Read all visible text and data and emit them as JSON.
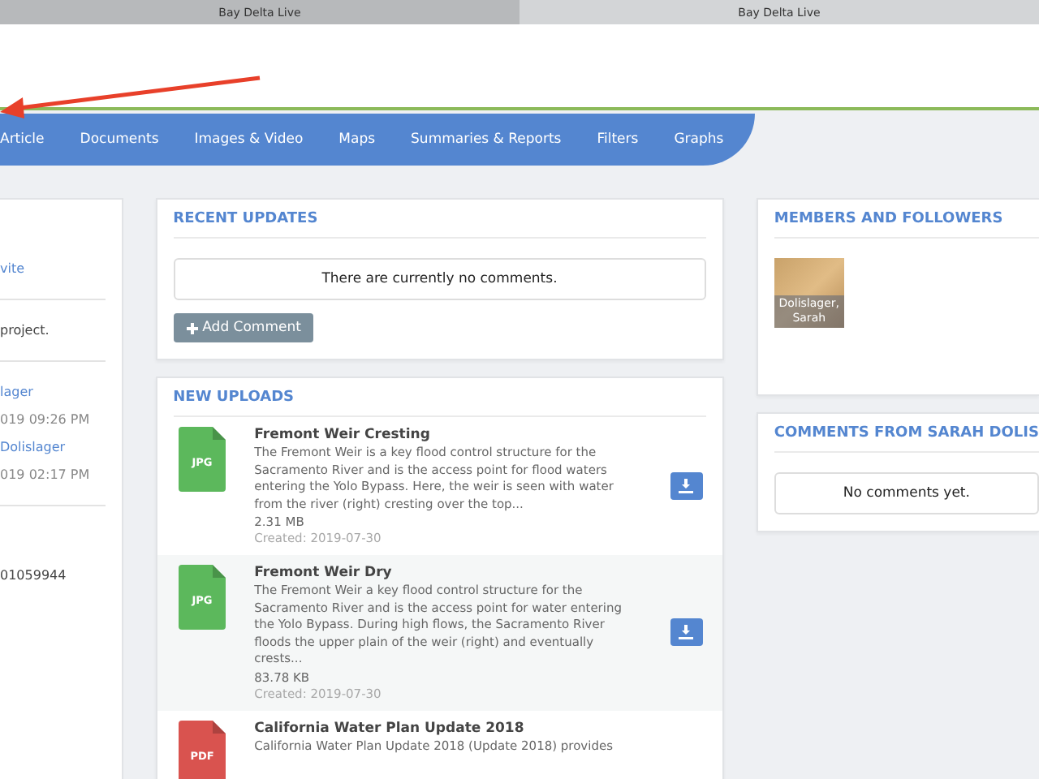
{
  "browser_tabs": [
    {
      "title": "Bay Delta Live",
      "selected": false
    },
    {
      "title": "Bay Delta Live",
      "selected": true
    }
  ],
  "nav": {
    "items": [
      {
        "label": "Article"
      },
      {
        "label": "Documents"
      },
      {
        "label": "Images & Video"
      },
      {
        "label": "Maps"
      },
      {
        "label": "Summaries & Reports"
      },
      {
        "label": "Filters"
      },
      {
        "label": "Graphs"
      }
    ]
  },
  "left_panel": {
    "sections": [
      {
        "items": [
          {
            "kind": "link",
            "text": "vite"
          }
        ]
      },
      {
        "items": [
          {
            "kind": "plain",
            "text": "project."
          }
        ]
      },
      {
        "items": [
          {
            "kind": "link",
            "text": "lager"
          },
          {
            "kind": "meta",
            "text": "019 09:26 PM"
          },
          {
            "kind": "link",
            "text": "Dolislager"
          },
          {
            "kind": "meta",
            "text": "019 02:17 PM"
          }
        ]
      },
      {
        "items": [
          {
            "kind": "plain",
            "text": "01059944"
          }
        ]
      }
    ]
  },
  "recent_updates": {
    "title": "RECENT UPDATES",
    "empty_message": "There are currently no comments.",
    "button": "Add Comment"
  },
  "new_uploads": {
    "title": "NEW UPLOADS",
    "items": [
      {
        "file_type": "JPG",
        "color": "#5cb85c",
        "title": "Fremont Weir Cresting",
        "description": "The Fremont Weir is a key flood control structure for the Sacramento River and is the access point for flood waters entering the Yolo Bypass. Here, the weir is seen with water from the river (right) cresting over the top...",
        "size": "2.31 MB",
        "created": "Created: 2019-07-30"
      },
      {
        "file_type": "JPG",
        "color": "#5cb85c",
        "title": "Fremont Weir Dry",
        "description": "The Fremont Weir a key flood control structure for the Sacramento River and is the access point for water entering the Yolo Bypass. During high flows, the Sacramento River floods the upper plain of the weir (right) and eventually crests...",
        "size": "83.78 KB",
        "created": "Created: 2019-07-30"
      },
      {
        "file_type": "PDF",
        "color": "#d9534f",
        "title": "California Water Plan Update 2018",
        "description": "California Water Plan Update 2018 (Update 2018) provides"
      }
    ]
  },
  "members": {
    "title": "MEMBERS AND FOLLOWERS",
    "items": [
      {
        "name": "Dolislager, Sarah"
      }
    ]
  },
  "comments": {
    "title": "COMMENTS FROM SARAH DOLIS",
    "empty_message": "No comments yet."
  }
}
